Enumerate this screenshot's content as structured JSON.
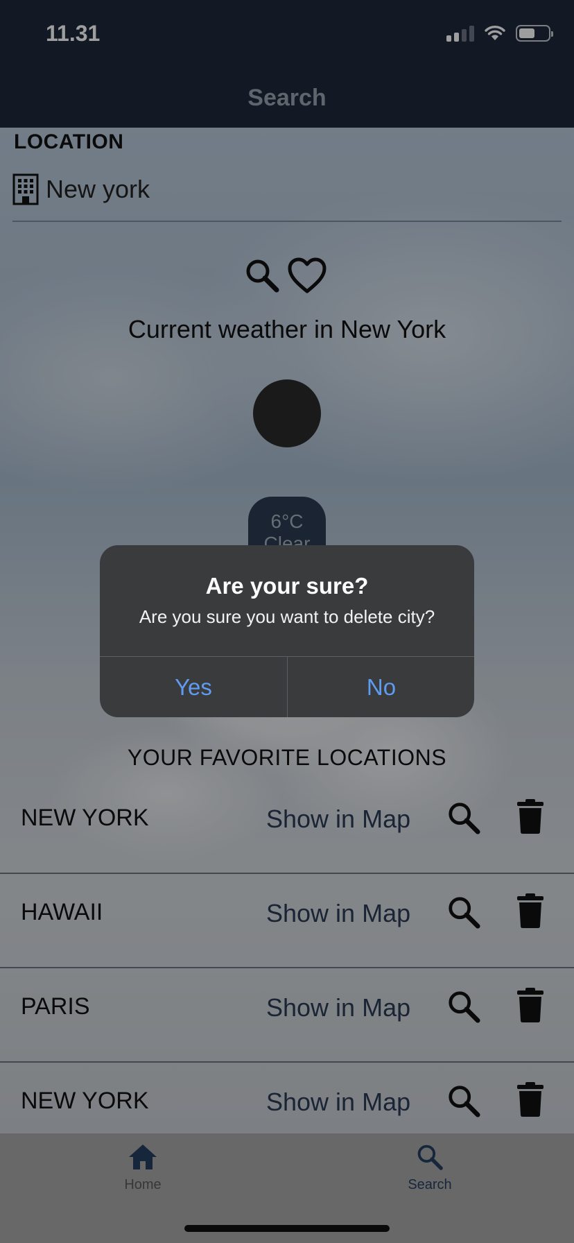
{
  "status_bar": {
    "time": "11.31"
  },
  "nav": {
    "title": "Search"
  },
  "location": {
    "label": "LOCATION",
    "value": "New york"
  },
  "weather": {
    "heading": "Current weather in New York",
    "temperature": "6°C",
    "condition": "Clear"
  },
  "favorites": {
    "title": "YOUR FAVORITE LOCATIONS",
    "items": [
      {
        "city": "NEW YORK",
        "map_label": "Show in Map"
      },
      {
        "city": "HAWAII",
        "map_label": "Show in Map"
      },
      {
        "city": "PARIS",
        "map_label": "Show in Map"
      },
      {
        "city": "NEW YORK",
        "map_label": "Show in Map"
      }
    ]
  },
  "dialog": {
    "title": "Are your sure?",
    "message": "Are you sure you want to delete city?",
    "yes_label": "Yes",
    "no_label": "No"
  },
  "tabs": [
    {
      "label": "Home",
      "icon": "home-icon"
    },
    {
      "label": "Search",
      "icon": "search-icon",
      "active": true
    }
  ],
  "colors": {
    "header": "#1d293c",
    "dialog_bg": "#3a3b3d",
    "dialog_button": "#5f9bef",
    "active_tab": "#26405f"
  }
}
